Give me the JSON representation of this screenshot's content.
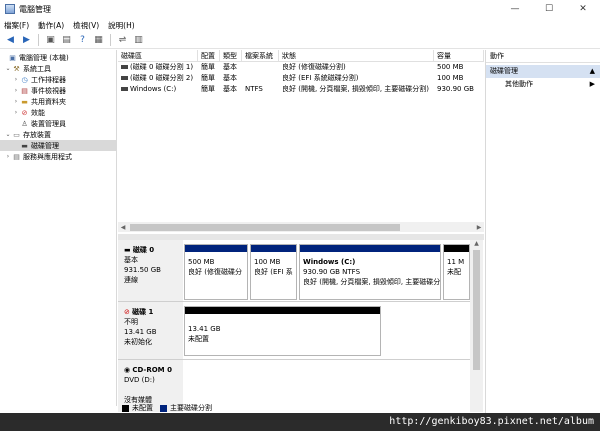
{
  "window": {
    "title": "電腦管理",
    "minimize": "—",
    "maximize": "☐",
    "close": "✕"
  },
  "menu": [
    "檔案(F)",
    "動作(A)",
    "檢視(V)",
    "說明(H)"
  ],
  "tree": {
    "root": "電腦管理 (本機)",
    "system_tools": "系統工具",
    "task_scheduler": "工作排程器",
    "event_viewer": "事件檢視器",
    "shared_folders": "共用資料夾",
    "performance": "效能",
    "device_manager": "裝置管理員",
    "storage": "存放裝置",
    "disk_management": "磁碟管理",
    "services": "服務與應用程式"
  },
  "volume_table": {
    "headers": [
      "磁碟區",
      "配置",
      "類型",
      "檔案系統",
      "狀態",
      "容量"
    ],
    "rows": [
      {
        "volume": "(磁碟 0 磁碟分割 1)",
        "layout": "簡單",
        "type": "基本",
        "fs": "",
        "status": "良好 (修復磁碟分割)",
        "capacity": "500 MB"
      },
      {
        "volume": "(磁碟 0 磁碟分割 2)",
        "layout": "簡單",
        "type": "基本",
        "fs": "",
        "status": "良好 (EFI 系統磁碟分割)",
        "capacity": "100 MB"
      },
      {
        "volume": "Windows (C:)",
        "layout": "簡單",
        "type": "基本",
        "fs": "NTFS",
        "status": "良好 (開機, 分頁檔案, 損毀傾印, 主要磁碟分割)",
        "capacity": "930.90 GB"
      }
    ]
  },
  "disks": {
    "disk0": {
      "name": "磁碟 0",
      "type": "基本",
      "size": "931.50 GB",
      "state": "連線",
      "p1": {
        "size": "500 MB",
        "status": "良好 (修復磁碟分"
      },
      "p2": {
        "size": "100 MB",
        "status": "良好 (EFI 系"
      },
      "p3": {
        "name": "Windows  (C:)",
        "size": "930.90 GB NTFS",
        "status": "良好 (開機, 分頁檔案, 損毀傾印, 主要磁碟分"
      },
      "p4": {
        "size": "11 M",
        "status": "未配"
      }
    },
    "disk1": {
      "name": "磁碟 1",
      "type": "不明",
      "size": "13.41 GB",
      "state": "未初始化",
      "p1": {
        "size": "13.41 GB",
        "status": "未配置"
      }
    },
    "cdrom0": {
      "name": "CD-ROM 0",
      "drive": "DVD (D:)",
      "media": "沒有媒體"
    }
  },
  "legend": {
    "unallocated": "未配置",
    "primary": "主要磁碟分割"
  },
  "actions": {
    "header": "動作",
    "section": "磁碟管理",
    "more": "其他動作",
    "arrow_up": "▲",
    "arrow_right": "▶"
  },
  "watermark": "http://genkiboy83.pixnet.net/album",
  "colors": {
    "primary_partition": "#00237c",
    "unallocated": "#000000",
    "action_section": "#d5e1f2"
  }
}
